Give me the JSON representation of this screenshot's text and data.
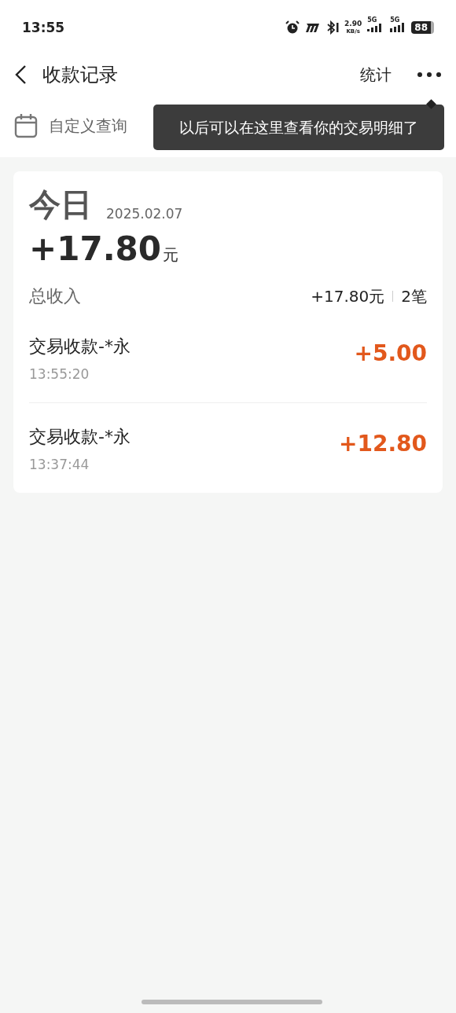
{
  "status_bar": {
    "time": "13:55",
    "speed": "2.90",
    "speed_unit": "KB/s",
    "sim1": "5G",
    "sim2": "5G",
    "battery": "88"
  },
  "header": {
    "title": "收款记录",
    "action": "统计"
  },
  "filter": {
    "label": "自定义查询"
  },
  "tooltip": {
    "text": "以后可以在这里查看你的交易明细了"
  },
  "summary": {
    "day": "今日",
    "date": "2025.02.07",
    "amount": "+17.80",
    "unit": "元",
    "total_label": "总收入",
    "total": "+17.80元",
    "count": "2笔"
  },
  "transactions": [
    {
      "title": "交易收款-*永",
      "time": "13:55:20",
      "amount": "+5.00"
    },
    {
      "title": "交易收款-*永",
      "time": "13:37:44",
      "amount": "+12.80"
    }
  ]
}
